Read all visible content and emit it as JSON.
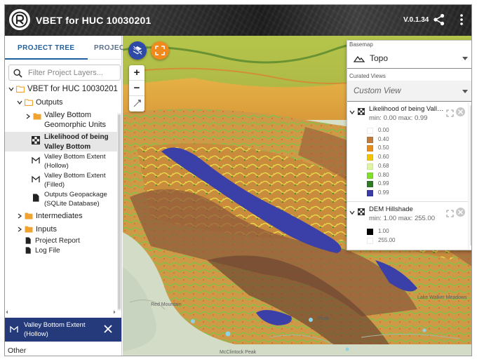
{
  "app": {
    "title": "VBET for HUC 10030201",
    "version": "V.0.1.34"
  },
  "sidebar": {
    "tabs": [
      {
        "label": "PROJECT TREE",
        "active": true
      },
      {
        "label": "PROJECT"
      }
    ],
    "search": {
      "placeholder": "Filter Project Layers...",
      "value": ""
    },
    "tree": {
      "root": "VBET for HUC 10030201",
      "outputs": "Outputs",
      "valley_bottom_geomorphic_units": "Valley Bottom Geomorphic Units",
      "vbgu_line1": "Valley Bottom",
      "vbgu_line2": "Geomorphic Units",
      "likelihood_line1": "Likelihood of being",
      "likelihood_line2": "Valley Bottom",
      "extent_hollow_line1": "Valley Bottom Extent",
      "extent_hollow_line2": "(Hollow)",
      "extent_filled_line1": "Valley Bottom Extent",
      "extent_filled_line2": "(Filled)",
      "geopackage_line1": "Outputs Geopackage",
      "geopackage_line2": "(SQLite Database)",
      "intermediates": "Intermediates",
      "inputs": "Inputs",
      "project_report": "Project Report",
      "log_file": "Log File"
    },
    "detail": {
      "title_line1": "Valley Bottom Extent",
      "title_line2": "(Hollow)",
      "section": "Other"
    }
  },
  "map": {
    "labels": {
      "red_mountain": "Red Mountain",
      "mcclintock_peak": "McClintock Peak",
      "peak": "Peak",
      "lake_walker": "Lake Walker Meadows"
    }
  },
  "panel": {
    "basemap_label": "Basemap",
    "basemap_value": "Topo",
    "curated_label": "Curated Views",
    "curated_value": "Custom View",
    "legends": [
      {
        "title": "Likelihood of being Valley Bottom",
        "title_display": "Likelihood of being Valley...",
        "range": "min: 0.00 max: 0.99",
        "entries": [
          {
            "value": "0.00",
            "color": "#ffffff"
          },
          {
            "value": "0.40",
            "color": "#c27b3c"
          },
          {
            "value": "0.50",
            "color": "#e88e18"
          },
          {
            "value": "0.60",
            "color": "#f5c400"
          },
          {
            "value": "0.68",
            "color": "#e1f5a0"
          },
          {
            "value": "0.80",
            "color": "#7fe02c"
          },
          {
            "value": "0.99",
            "color": "#2f7a23"
          },
          {
            "value": "0.99",
            "color": "#3a3aa8"
          }
        ]
      },
      {
        "title": "DEM Hillshade",
        "title_display": "DEM Hillshade",
        "range": "min: 1.00 max: 255.00",
        "entries": [
          {
            "value": "1.00",
            "color": "#000000"
          },
          {
            "value": "255.00",
            "color": "#ffffff"
          }
        ]
      }
    ]
  },
  "colors": {
    "accent": "#2f4aa6",
    "orange": "#f08a1c",
    "header_dark": "#243a7a",
    "tab_active": "#1f5f9c"
  }
}
